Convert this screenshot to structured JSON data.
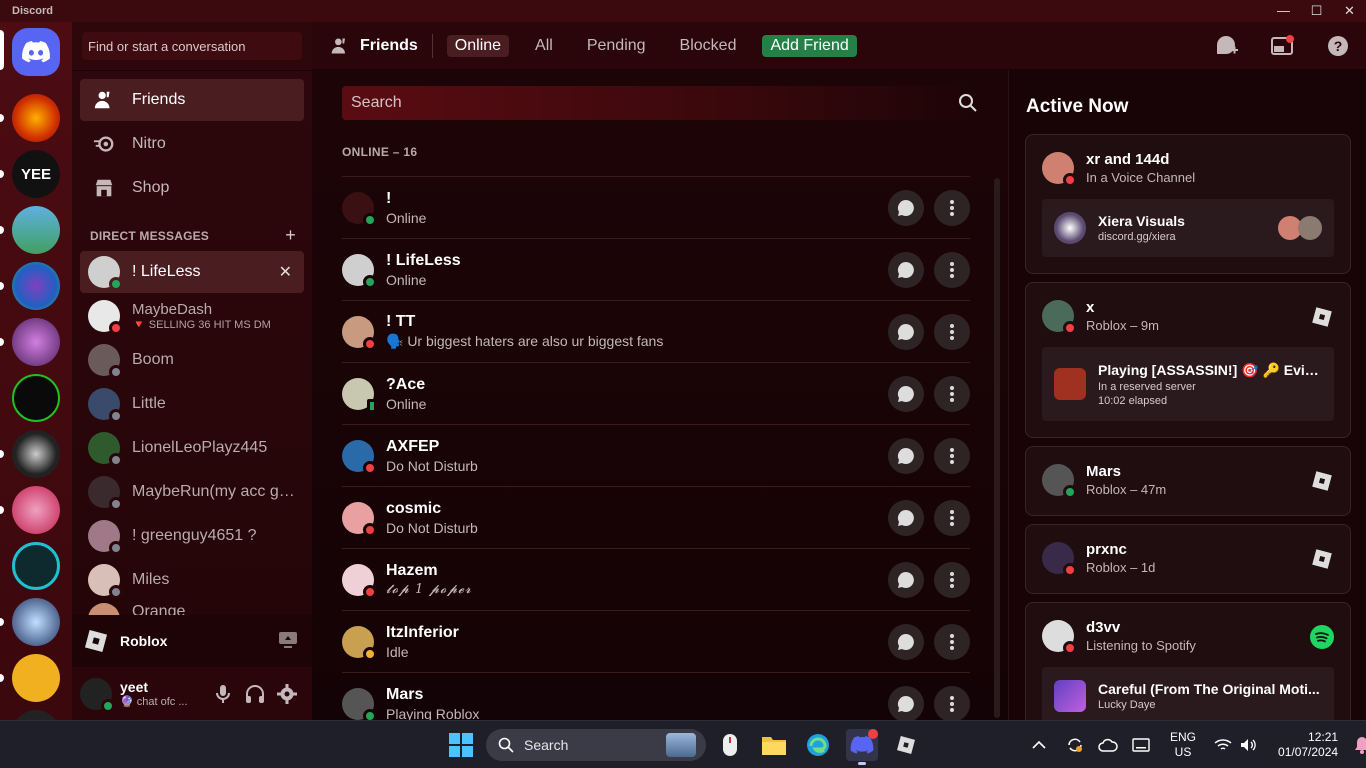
{
  "window": {
    "app_name": "Discord",
    "minimize": "—",
    "maximize": "☐",
    "close": "✕"
  },
  "sidebar": {
    "search_placeholder": "Find or start a conversation",
    "nav": [
      {
        "label": "Friends"
      },
      {
        "label": "Nitro"
      },
      {
        "label": "Shop"
      }
    ],
    "dm_header": "DIRECT MESSAGES",
    "dm_add": "+",
    "dms": [
      {
        "name": "! LifeLess",
        "sub": "",
        "status": "online",
        "color": "#cfcfcf"
      },
      {
        "name": "MaybeDash",
        "sub": "SELLING 36 HIT MS DM",
        "status": "dnd",
        "color": "#e8e8e8"
      },
      {
        "name": "Boom",
        "sub": "",
        "status": "offline",
        "color": "#6b5a5a"
      },
      {
        "name": "Little",
        "sub": "",
        "status": "offline",
        "color": "#3a4a6a"
      },
      {
        "name": "LionelLeoPlayz445",
        "sub": "",
        "status": "offline",
        "color": "#2e5a2e"
      },
      {
        "name": "MaybeRun(my acc got...",
        "sub": "",
        "status": "offline",
        "color": "#3a2a2e"
      },
      {
        "name": "! greenguy4651 ?",
        "sub": "",
        "status": "offline",
        "color": "#a07888"
      },
      {
        "name": "Miles",
        "sub": "",
        "status": "offline",
        "color": "#d8c0b8"
      },
      {
        "name": "Orange",
        "sub": "",
        "status": "offline",
        "color": "#c89070"
      }
    ],
    "activity": {
      "label": "Roblox"
    },
    "user": {
      "name": "yeet",
      "status": "chat ofc ..."
    }
  },
  "header": {
    "title": "Friends",
    "tabs": [
      {
        "label": "Online"
      },
      {
        "label": "All"
      },
      {
        "label": "Pending"
      },
      {
        "label": "Blocked"
      },
      {
        "label": "Add Friend"
      }
    ]
  },
  "friends": {
    "search_placeholder": "Search",
    "count_label": "ONLINE – 16",
    "list": [
      {
        "name": "!",
        "status_text": "Online",
        "status": "online",
        "color": "#3a1012"
      },
      {
        "name": "! LifeLess",
        "status_text": "Online",
        "status": "online",
        "color": "#cfcfcf"
      },
      {
        "name": "! TT",
        "status_text": "🗣️ Ur biggest haters are also ur biggest fans",
        "status": "dnd",
        "color": "#c89a80"
      },
      {
        "name": "?Ace",
        "status_text": "Online",
        "status": "mobile",
        "color": "#c8c8b0"
      },
      {
        "name": "AXFEP",
        "status_text": "Do Not Disturb",
        "status": "dnd",
        "color": "#2a6aa8"
      },
      {
        "name": "cosmic",
        "status_text": "Do Not Disturb",
        "status": "dnd",
        "color": "#e8a0a0"
      },
      {
        "name": "Hazem",
        "status_text": "𝓽𝓸𝓹 1 𝓹𝓸𝓹𝓮𝓻",
        "status": "dnd",
        "color": "#f0d0d8"
      },
      {
        "name": "ItzInferior",
        "status_text": "Idle",
        "status": "idle",
        "color": "#c8a050"
      },
      {
        "name": "Mars",
        "status_text": "Playing Roblox",
        "status": "online",
        "color": "#555"
      }
    ]
  },
  "active_now": {
    "title": "Active Now",
    "cards": [
      {
        "name": "xr and 144d",
        "sub": "In a Voice Channel",
        "status": "dnd",
        "color": "#d08070",
        "inner_title": "Xiera Visuals",
        "inner_sub": "discord.gg/xiera",
        "inner_sub2": ""
      },
      {
        "name": "x",
        "sub": "Roblox – 9m",
        "status": "dnd",
        "color": "#4a6a5a",
        "inner_title": "Playing [ASSASSIN!] 🎯 🔑 Evictio...",
        "inner_sub": "In a reserved server",
        "inner_sub2": "10:02 elapsed"
      },
      {
        "name": "Mars",
        "sub": "Roblox – 47m",
        "status": "online",
        "color": "#555"
      },
      {
        "name": "prxnc",
        "sub": "Roblox – 1d",
        "status": "dnd",
        "color": "#3a2a4a"
      },
      {
        "name": "d3vv",
        "sub": "Listening to Spotify",
        "status": "dnd",
        "color": "#ddd",
        "inner_title": "Careful (From The Original Moti...",
        "inner_sub": "Lucky Daye",
        "inner_sub2": ""
      }
    ]
  },
  "taskbar": {
    "search_label": "Search",
    "lang": "ENG",
    "region": "US",
    "time": "12:21",
    "date": "01/07/2024"
  }
}
